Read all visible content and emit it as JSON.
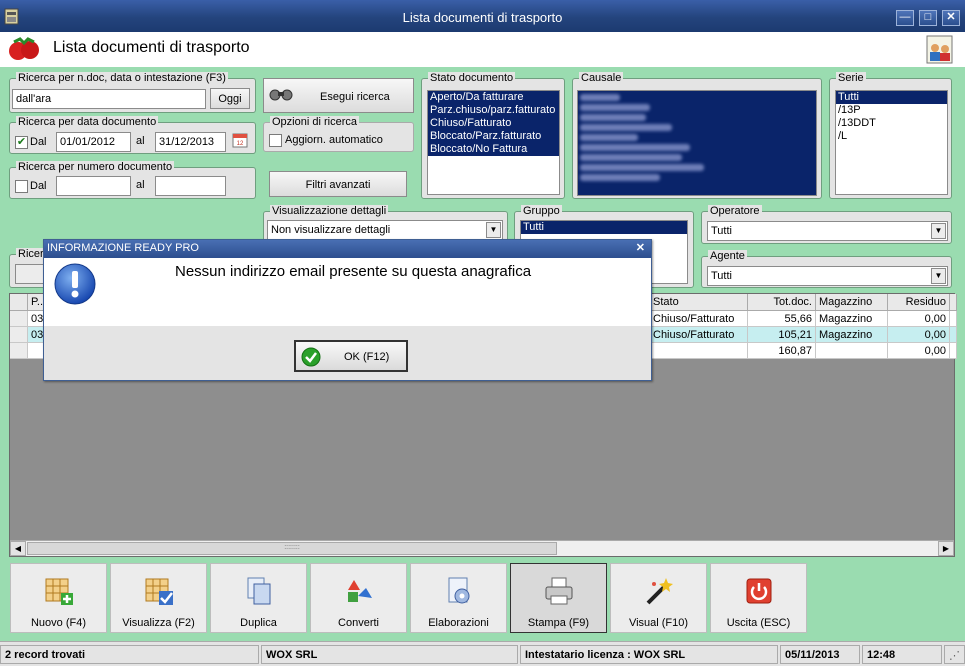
{
  "window": {
    "title": "Lista documenti di trasporto"
  },
  "header": {
    "title": "Lista documenti di trasporto"
  },
  "search": {
    "group_label": "Ricerca per n.doc, data o intestazione (F3)",
    "value": "dall'ara",
    "oggi_label": "Oggi"
  },
  "date_search": {
    "group_label": "Ricerca per data documento",
    "dal_label": "Dal",
    "dal_checked": true,
    "from": "01/01/2012",
    "al_label": "al",
    "to": "31/12/2013"
  },
  "number_search": {
    "group_label": "Ricerca per numero documento",
    "dal_label": "Dal",
    "al_label": "al",
    "from": "",
    "to": ""
  },
  "ricerca_partial": "Ricerc",
  "actions": {
    "esegui_label": "Esegui ricerca",
    "opzioni_label": "Opzioni di ricerca",
    "aggiorn_label": "Aggiorn. automatico",
    "filtri_label": "Filtri avanzati"
  },
  "stato": {
    "label": "Stato documento",
    "items": [
      "Aperto/Da fatturare",
      "Parz.chiuso/parz.fatturato",
      "Chiuso/Fatturato",
      "Bloccato/Parz.fatturato",
      "Bloccato/No Fattura"
    ]
  },
  "causale": {
    "label": "Causale"
  },
  "serie": {
    "label": "Serie",
    "items": [
      "Tutti",
      "/13P",
      "/13DDT",
      "/L"
    ]
  },
  "visualizzazione": {
    "label": "Visualizzazione dettagli",
    "value": "Non visualizzare dettagli"
  },
  "gruppo": {
    "label": "Gruppo",
    "value": "Tutti"
  },
  "operatore": {
    "label": "Operatore",
    "value": "Tutti"
  },
  "agente": {
    "label": "Agente",
    "value": "Tutti"
  },
  "grid": {
    "columns": {
      "p": "P...",
      "stato": "Stato",
      "tot": "Tot.doc.",
      "mag": "Magazzino",
      "residuo": "Residuo"
    },
    "rows": [
      {
        "p": "03",
        "stato": "Chiuso/Fatturato",
        "tot": "55,66",
        "mag": "Magazzino",
        "residuo": "0,00"
      },
      {
        "p": "03",
        "stato": "Chiuso/Fatturato",
        "tot": "105,21",
        "mag": "Magazzino",
        "residuo": "0,00"
      }
    ],
    "totals": {
      "tot": "160,87",
      "residuo": "0,00"
    }
  },
  "toolbar": [
    {
      "label": "Nuovo (F4)",
      "icon": "new-grid-icon"
    },
    {
      "label": "Visualizza (F2)",
      "icon": "view-grid-icon"
    },
    {
      "label": "Duplica",
      "icon": "duplicate-icon"
    },
    {
      "label": "Converti",
      "icon": "convert-icon"
    },
    {
      "label": "Elaborazioni",
      "icon": "processing-icon"
    },
    {
      "label": "Stampa (F9)",
      "icon": "printer-icon"
    },
    {
      "label": "Visual (F10)",
      "icon": "magic-wand-icon"
    },
    {
      "label": "Uscita (ESC)",
      "icon": "power-icon"
    }
  ],
  "status": {
    "records": "2 record trovati",
    "company": "WOX SRL",
    "license": "Intestatario licenza : WOX SRL",
    "date": "05/11/2013",
    "time": "12:48"
  },
  "dialog": {
    "title": "INFORMAZIONE READY PRO",
    "message": "Nessun indirizzo email presente su questa anagrafica",
    "ok_label": "OK (F12)"
  },
  "colors": {
    "background": "#9adcb0",
    "title_bar": "#24447d",
    "selection": "#0a246a",
    "highlight_row": "#c6eef0"
  }
}
